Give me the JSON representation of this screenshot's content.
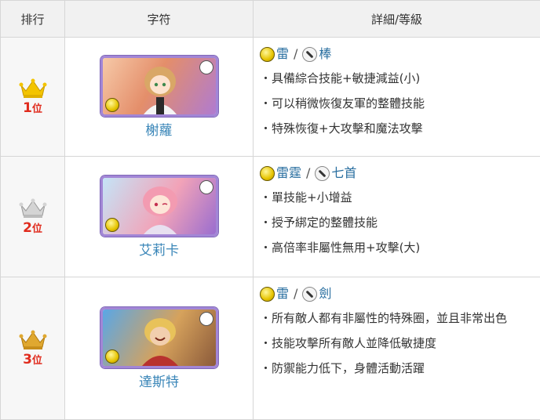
{
  "headers": {
    "rank": "排行",
    "character": "字符",
    "detail": "詳細/等級"
  },
  "rows": [
    {
      "rank_num": "1",
      "rank_suffix": "位",
      "crown_color": "#f3c400",
      "name": "榭蘿",
      "portrait_colors": [
        "#f6c9a8",
        "#e48e6a",
        "#b07bd0"
      ],
      "element_icon": "thunder-orb-icon",
      "element": "雷",
      "weapon_icon": "staff-icon",
      "weapon": "棒",
      "bullets": [
        "・具備綜合技能+敏捷減益(小)",
        "・可以稍微恢復友軍的整體技能",
        "・特殊恢復+大攻擊和魔法攻擊"
      ]
    },
    {
      "rank_num": "2",
      "rank_suffix": "位",
      "crown_color": "#c9c9c9",
      "name": "艾莉卡",
      "portrait_colors": [
        "#c4e4f7",
        "#f2a3b8",
        "#9a6dcf"
      ],
      "element_icon": "thunder-orb-icon",
      "element": "雷霆",
      "weapon_icon": "dagger-icon",
      "weapon": "七首",
      "bullets": [
        "・單技能+小增益",
        "・授予綁定的整體技能",
        "・高倍率非屬性無用+攻擊(大)"
      ]
    },
    {
      "rank_num": "3",
      "rank_suffix": "位",
      "crown_color": "#e0a830",
      "name": "達斯特",
      "portrait_colors": [
        "#5aa7e6",
        "#d6a25c",
        "#8b5a3a"
      ],
      "element_icon": "thunder-orb-icon",
      "element": "雷",
      "weapon_icon": "sword-icon",
      "weapon": "劍",
      "bullets": [
        "・所有敵人都有非屬性的特殊圈，並且非常出色",
        "・技能攻擊所有敵人並降低敏捷度",
        "・防禦能力低下，身體活動活躍"
      ]
    }
  ]
}
